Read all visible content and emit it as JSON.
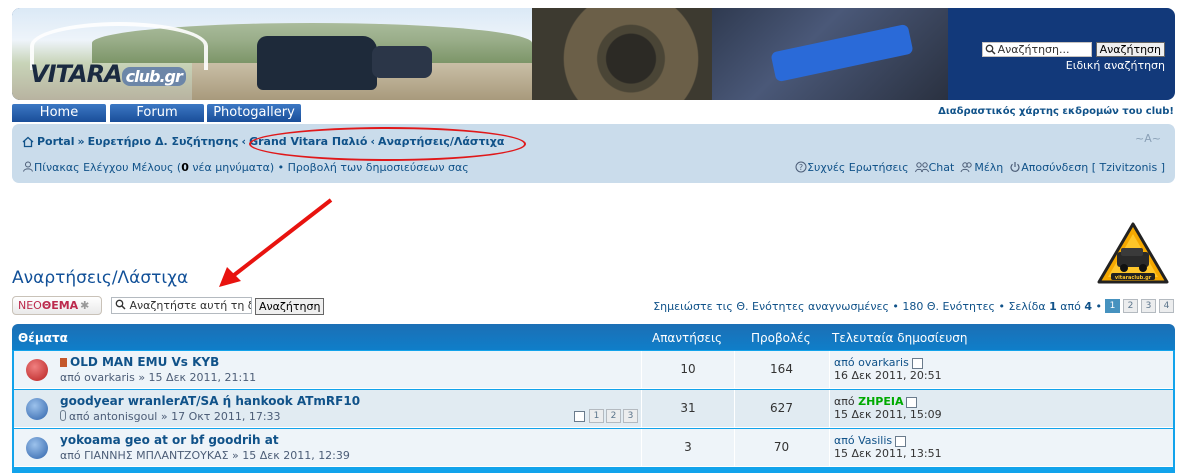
{
  "header": {
    "logo_main": "VITARA",
    "logo_suffix": "club.gr",
    "search_placeholder": "Αναζήτηση...",
    "search_button": "Αναζήτηση",
    "advanced_search": "Ειδική αναζήτηση"
  },
  "nav": {
    "home": "Home",
    "forum": "Forum",
    "photogallery": "Photogallery",
    "map_link": "Διαδραστικός χάρτης εκδρομών του club!"
  },
  "breadcrumb": {
    "portal": "Portal",
    "sep1": "»",
    "index": "Ευρετήριο Δ. Συζήτησης",
    "sep2": "‹",
    "parent": "Grand Vitara Παλιό",
    "sep3": "‹",
    "current": "Αναρτήσεις/Λάστιχα",
    "font_size": "~A~"
  },
  "userbar": {
    "ucp": "Πίνακας Ελέγχου Μέλους (",
    "new_count": "0",
    "ucp_suffix": " νέα μηνύματα)",
    "sep": " • ",
    "view_posts": "Προβολή των δημοσιεύσεων σας",
    "faq": "Συχνές Ερωτήσεις",
    "chat": "Chat",
    "members": "Μέλη",
    "logout": "Αποσύνδεση [ Tzivitzonis ]"
  },
  "forum": {
    "title": "Αναρτήσεις/Λάστιχα",
    "new_topic_prefix": "ΝΕΟ",
    "new_topic_bold": "ΘΕΜΑ",
    "search_placeholder": "Αναζητήστε αυτή τη δ. συζήτηση...",
    "search_button": "Αναζήτηση",
    "pagination_text": "Σημειώστε τις Θ. Ενότητες αναγνωσμένες • 180 Θ. Ενότητες • Σελίδα ",
    "page_current": "1",
    "page_of": " από ",
    "page_total": "4",
    "page_bullet": " • ",
    "pages": [
      "1",
      "2",
      "3",
      "4"
    ]
  },
  "table": {
    "headers": {
      "topics": "Θέματα",
      "replies": "Απαντήσεις",
      "views": "Προβολές",
      "last_post": "Τελευταία δημοσίευση"
    },
    "rows": [
      {
        "title": "OLD MAN EMU Vs KYB",
        "meta": "από ovarkaris » 15 Δεκ 2011, 21:11",
        "replies": "10",
        "views": "164",
        "last_by": "από ovarkaris",
        "last_date": "16 Δεκ 2011, 20:51",
        "icon_color": "#c0392b"
      },
      {
        "title": "goodyear wranlerAT/SA ή hankook ATmRF10",
        "meta": "από antonisgoul » 17 Οκτ 2011, 17:33",
        "replies": "31",
        "views": "627",
        "last_by_prefix": "από ",
        "last_by_name": "ZHPEIA",
        "last_date": "15 Δεκ 2011, 15:09",
        "pages": [
          "1",
          "2",
          "3"
        ],
        "icon_color": "#3a6fb8"
      },
      {
        "title": "yokoama geo at or bf goodrih at",
        "meta": "από ΓΙΑΝΝΗΣ ΜΠΛΑΝΤΖΟΥΚΑΣ » 15 Δεκ 2011, 12:39",
        "replies": "3",
        "views": "70",
        "last_by": "από Vasilis",
        "last_date": "15 Δεκ 2011, 13:51",
        "icon_color": "#3a6fb8"
      }
    ]
  },
  "emblem": {
    "text": "vitaraclub.gr"
  }
}
